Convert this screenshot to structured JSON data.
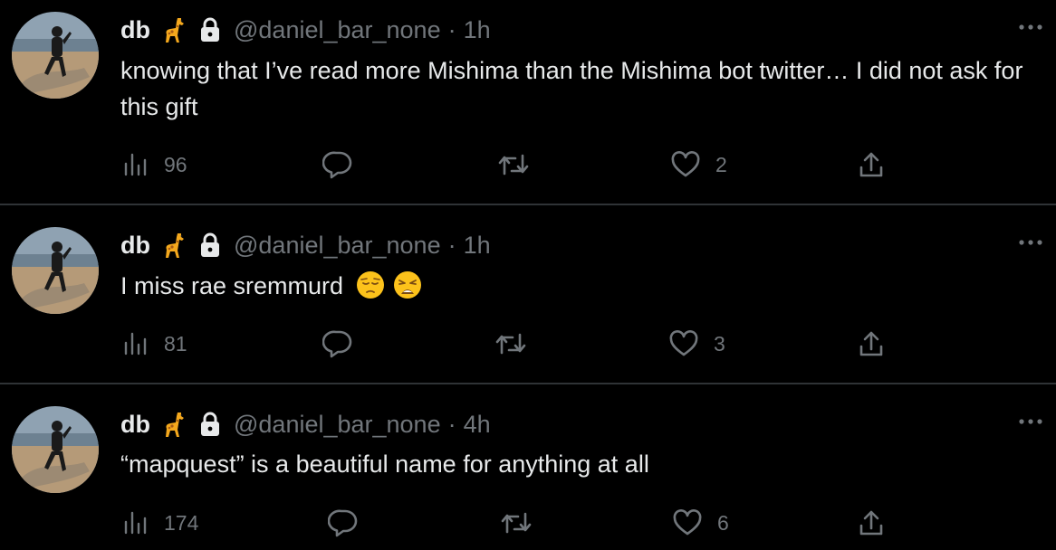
{
  "tweets": [
    {
      "name": "db",
      "handle": "@daniel_bar_none",
      "dot": "·",
      "time": "1h",
      "text": "knowing that I’ve read more Mishima than the Mishima bot twitter… I did not ask for this gift",
      "views": "96",
      "replies": "",
      "retweets": "",
      "likes": "2",
      "emojis": []
    },
    {
      "name": "db",
      "handle": "@daniel_bar_none",
      "dot": "·",
      "time": "1h",
      "text": "I miss rae sremmurd",
      "views": "81",
      "replies": "",
      "retweets": "",
      "likes": "3",
      "emojis": [
        "pensive-face-emoji",
        "weary-face-emoji"
      ]
    },
    {
      "name": "db",
      "handle": "@daniel_bar_none",
      "dot": "·",
      "time": "4h",
      "text": "“mapquest” is a beautiful name for anything at all",
      "views": "174",
      "replies": "",
      "retweets": "",
      "likes": "6",
      "emojis": []
    }
  ],
  "colors": {
    "background": "#000000",
    "text": "#e7e9ea",
    "muted": "#71767b",
    "divider": "#2f3336"
  }
}
